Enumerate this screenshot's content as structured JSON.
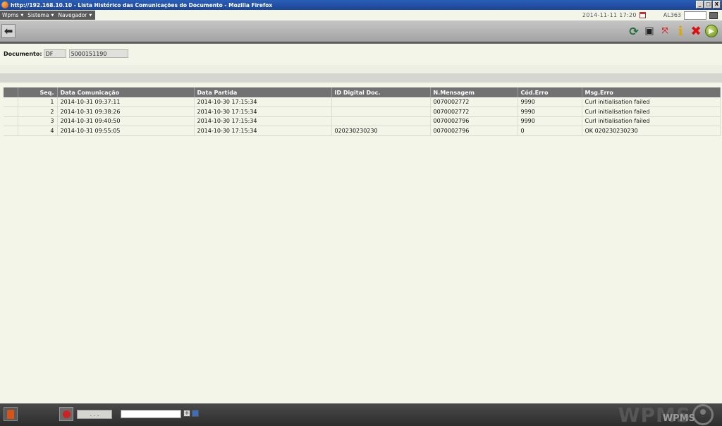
{
  "window": {
    "title": "http://192.168.10.10 - Lista Histórico das Comunicações do Documento - Mozilla Firefox",
    "controls": [
      "_",
      "□",
      "X"
    ]
  },
  "menu": {
    "items": [
      {
        "label": "Wpms"
      },
      {
        "label": "Sistema"
      },
      {
        "label": "Navegador"
      }
    ],
    "datetime": "2014-11-11  17:20",
    "user": "AL363"
  },
  "toolbar": {
    "icons": [
      "refresh-icon",
      "screen-icon",
      "expand-icon",
      "info-icon",
      "close-icon",
      "go-icon"
    ]
  },
  "document": {
    "label": "Documento:",
    "type": "DF",
    "number": "5000151190"
  },
  "table": {
    "columns": [
      "",
      "Seq.",
      "Data Comunicação",
      "Data Partida",
      "ID Digital Doc.",
      "N.Mensagem",
      "Cód.Erro",
      "Msg.Erro"
    ],
    "rows": [
      {
        "seq": "1",
        "data_comunicacao": "2014-10-31  09:37:11",
        "data_partida": "2014-10-30  17:15:34",
        "id_digital": "",
        "n_mensagem": "0070002772",
        "cod_erro": "9990",
        "msg_erro": "Curl initialisation failed"
      },
      {
        "seq": "2",
        "data_comunicacao": "2014-10-31  09:38:26",
        "data_partida": "2014-10-30  17:15:34",
        "id_digital": "",
        "n_mensagem": "0070002772",
        "cod_erro": "9990",
        "msg_erro": "Curl initialisation failed"
      },
      {
        "seq": "3",
        "data_comunicacao": "2014-10-31  09:40:50",
        "data_partida": "2014-10-30  17:15:34",
        "id_digital": "",
        "n_mensagem": "0070002796",
        "cod_erro": "9990",
        "msg_erro": "Curl initialisation failed"
      },
      {
        "seq": "4",
        "data_comunicacao": "2014-10-31  09:55:05",
        "data_partida": "2014-10-30  17:15:34",
        "id_digital": "020230230230",
        "n_mensagem": "0070002796",
        "cod_erro": "0",
        "msg_erro": "OK 020230230230"
      }
    ]
  },
  "bottom": {
    "dots_label": ". . .",
    "logo": "WPMS",
    "logo_sub": "WPMS"
  }
}
